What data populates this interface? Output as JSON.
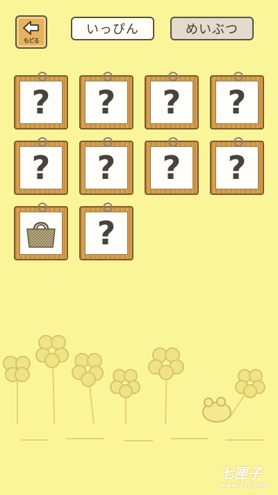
{
  "header": {
    "back_label": "もどる",
    "tabs": [
      {
        "label": "いっぴん",
        "selected": true
      },
      {
        "label": "めいぶつ",
        "selected": false
      }
    ]
  },
  "grid": {
    "unknown_symbol": "?",
    "cards": [
      {
        "state": "unknown"
      },
      {
        "state": "unknown"
      },
      {
        "state": "unknown"
      },
      {
        "state": "unknown"
      },
      {
        "state": "unknown"
      },
      {
        "state": "unknown"
      },
      {
        "state": "unknown"
      },
      {
        "state": "unknown"
      },
      {
        "state": "found",
        "icon": "tote-bag-icon"
      },
      {
        "state": "unknown"
      }
    ]
  },
  "watermark": {
    "text": "七匣子",
    "url": "www.7xz.com"
  }
}
